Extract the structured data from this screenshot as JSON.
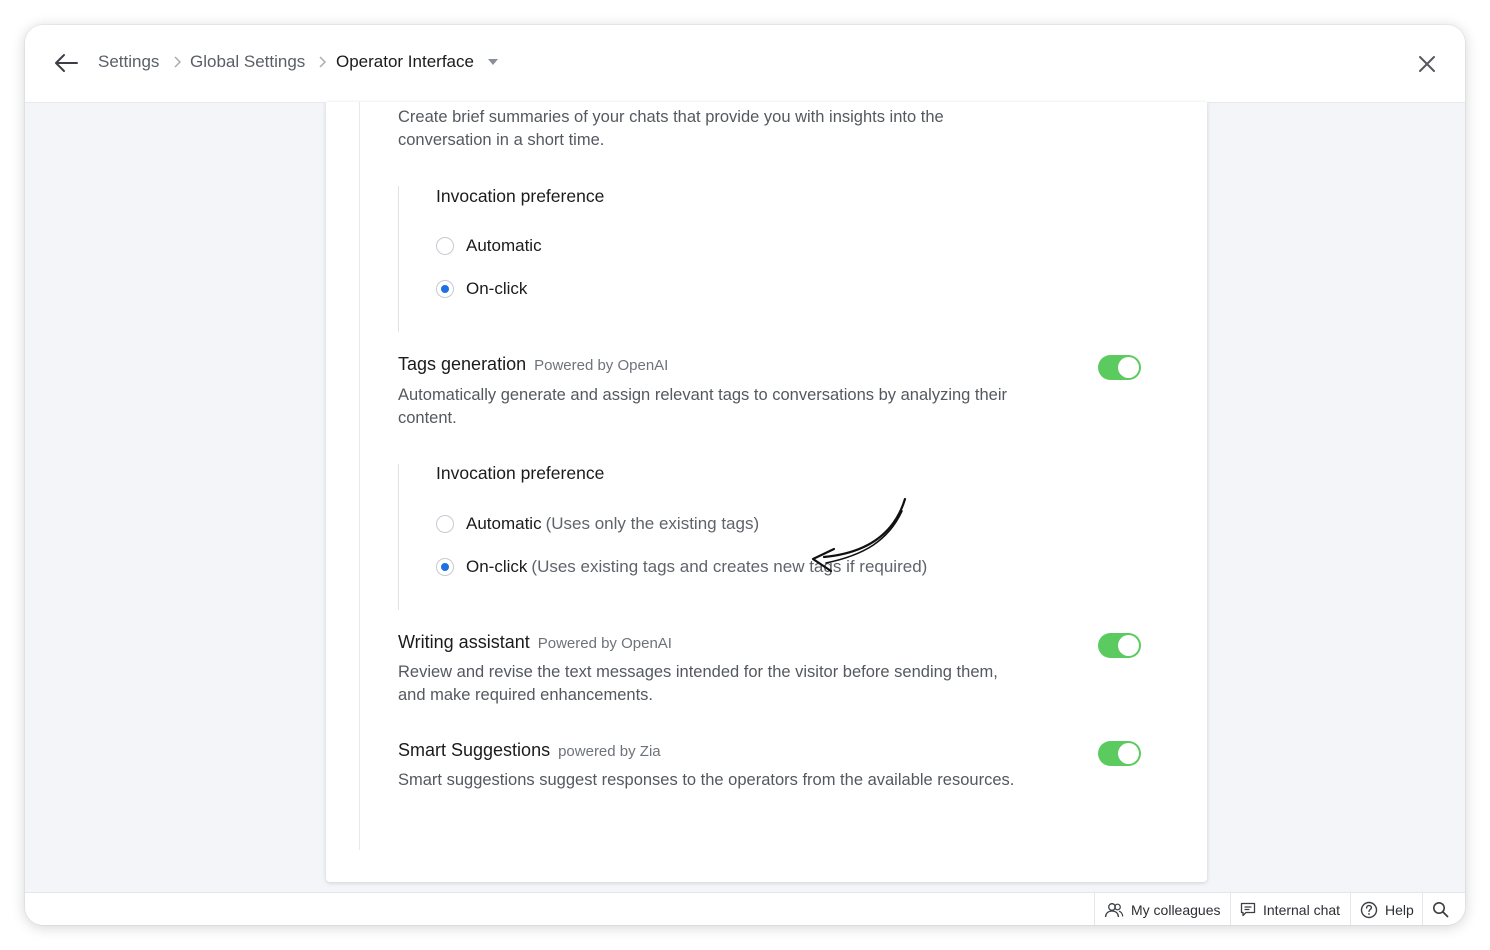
{
  "header": {
    "breadcrumbs": [
      "Settings",
      "Global Settings",
      "Operator Interface"
    ]
  },
  "chat_summary": {
    "description": "Create brief summaries of your chats that provide you with insights into the conversation in a short time.",
    "preference_title": "Invocation preference",
    "options": [
      {
        "label": "Automatic",
        "note": "",
        "selected": false
      },
      {
        "label": "On-click",
        "note": "",
        "selected": true
      }
    ]
  },
  "tags_generation": {
    "title": "Tags generation",
    "powered": "Powered by OpenAI",
    "enabled": true,
    "description": "Automatically generate and assign relevant tags to conversations by analyzing their content.",
    "preference_title": "Invocation preference",
    "options": [
      {
        "label": "Automatic",
        "note": "(Uses only the existing tags)",
        "selected": false
      },
      {
        "label": "On-click",
        "note": "(Uses existing tags and creates new tags if required)",
        "selected": true
      }
    ]
  },
  "writing_assistant": {
    "title": "Writing assistant",
    "powered": "Powered by OpenAI",
    "enabled": true,
    "description": "Review and revise the text messages intended for the visitor before sending them, and make required enhancements."
  },
  "smart_suggestions": {
    "title": "Smart Suggestions",
    "powered": "powered by Zia",
    "enabled": true,
    "description": "Smart suggestions suggest responses to the operators from the available resources."
  },
  "bottom_bar": {
    "colleagues": "My colleagues",
    "internal_chat": "Internal chat",
    "help": "Help"
  },
  "colors": {
    "toggle_on": "#5ccb5f",
    "radio_selected": "#1f6fe5"
  }
}
